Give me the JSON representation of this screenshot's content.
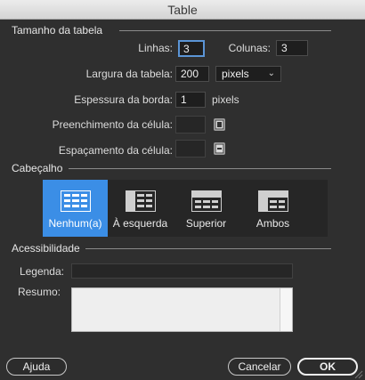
{
  "window": {
    "title": "Table"
  },
  "table_size": {
    "section_label": "Tamanho da tabela",
    "rows_label": "Linhas:",
    "rows_value": "3",
    "cols_label": "Colunas:",
    "cols_value": "3",
    "width_label": "Largura da tabela:",
    "width_value": "200",
    "width_unit": "pixels",
    "border_label": "Espessura da borda:",
    "border_value": "1",
    "border_unit": "pixels",
    "padding_label": "Preenchimento da célula:",
    "padding_value": "",
    "spacing_label": "Espaçamento da célula:",
    "spacing_value": ""
  },
  "header": {
    "section_label": "Cabeçalho",
    "options": [
      {
        "label": "Nenhum(a)",
        "selected": true
      },
      {
        "label": "À esquerda",
        "selected": false
      },
      {
        "label": "Superior",
        "selected": false
      },
      {
        "label": "Ambos",
        "selected": false
      }
    ]
  },
  "accessibility": {
    "section_label": "Acessibilidade",
    "caption_label": "Legenda:",
    "caption_value": "",
    "summary_label": "Resumo:",
    "summary_value": ""
  },
  "buttons": {
    "help": "Ajuda",
    "cancel": "Cancelar",
    "ok": "OK"
  },
  "colors": {
    "selected_accent": "#3b8ee6",
    "background": "#2f2f2f"
  }
}
